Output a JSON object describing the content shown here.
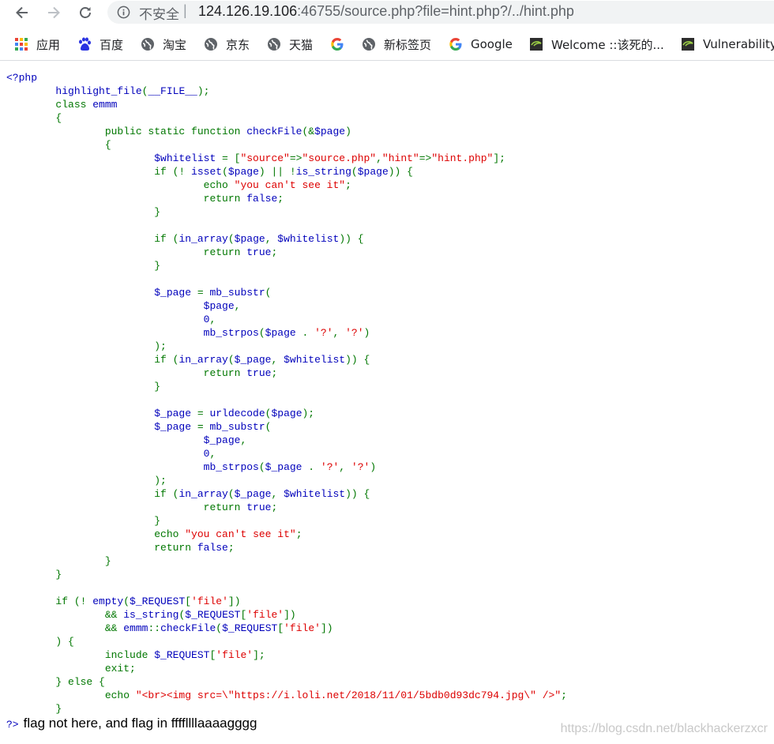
{
  "browser": {
    "security_label": "不安全",
    "separator": "|",
    "url_host": "124.126.19.106",
    "url_rest": ":46755/source.php?file=hint.php?/../hint.php",
    "bookmarks": [
      {
        "label": "应用",
        "icon": "apps-grid-icon"
      },
      {
        "label": "百度",
        "icon": "baidu-paw-icon"
      },
      {
        "label": "淘宝",
        "icon": "globe-icon"
      },
      {
        "label": "京东",
        "icon": "globe-icon"
      },
      {
        "label": "天猫",
        "icon": "globe-icon"
      },
      {
        "label": "",
        "icon": "google-g-icon"
      },
      {
        "label": "新标签页",
        "icon": "globe-icon"
      },
      {
        "label": "Google",
        "icon": "google-g-icon"
      },
      {
        "label": "Welcome ::该死的...",
        "icon": "dvwa-icon"
      },
      {
        "label": "Vulnerability",
        "icon": "dvwa-icon"
      }
    ]
  },
  "colors": {
    "keyword": "#0000bb",
    "string": "#dd0000",
    "operator": "#007700",
    "default": "#000000"
  },
  "code_lines": [
    [
      [
        "k",
        "<?php"
      ]
    ],
    [
      [
        "k",
        "        highlight_file"
      ],
      [
        "o",
        "("
      ],
      [
        "k",
        "__FILE__"
      ],
      [
        "o",
        ");"
      ]
    ],
    [
      [
        "o",
        "        class "
      ],
      [
        "k",
        "emmm"
      ]
    ],
    [
      [
        "o",
        "        {"
      ]
    ],
    [
      [
        "o",
        "                public static function "
      ],
      [
        "k",
        "checkFile"
      ],
      [
        "o",
        "(&"
      ],
      [
        "k",
        "$page"
      ],
      [
        "o",
        ")"
      ]
    ],
    [
      [
        "o",
        "                {"
      ]
    ],
    [
      [
        "k",
        "                        $whitelist "
      ],
      [
        "o",
        "= ["
      ],
      [
        "s",
        "\"source\""
      ],
      [
        "o",
        "=>"
      ],
      [
        "s",
        "\"source.php\""
      ],
      [
        "o",
        ","
      ],
      [
        "s",
        "\"hint\""
      ],
      [
        "o",
        "=>"
      ],
      [
        "s",
        "\"hint.php\""
      ],
      [
        "o",
        "];"
      ]
    ],
    [
      [
        "o",
        "                        if (! "
      ],
      [
        "k",
        "isset"
      ],
      [
        "o",
        "("
      ],
      [
        "k",
        "$page"
      ],
      [
        "o",
        ") || !"
      ],
      [
        "k",
        "is_string"
      ],
      [
        "o",
        "("
      ],
      [
        "k",
        "$page"
      ],
      [
        "o",
        ")) {"
      ]
    ],
    [
      [
        "o",
        "                                echo "
      ],
      [
        "s",
        "\"you can't see it\""
      ],
      [
        "o",
        ";"
      ]
    ],
    [
      [
        "o",
        "                                return "
      ],
      [
        "k",
        "false"
      ],
      [
        "o",
        ";"
      ]
    ],
    [
      [
        "o",
        "                        }"
      ]
    ],
    [
      [
        "o",
        ""
      ]
    ],
    [
      [
        "o",
        "                        if ("
      ],
      [
        "k",
        "in_array"
      ],
      [
        "o",
        "("
      ],
      [
        "k",
        "$page"
      ],
      [
        "o",
        ", "
      ],
      [
        "k",
        "$whitelist"
      ],
      [
        "o",
        ")) {"
      ]
    ],
    [
      [
        "o",
        "                                return "
      ],
      [
        "k",
        "true"
      ],
      [
        "o",
        ";"
      ]
    ],
    [
      [
        "o",
        "                        }"
      ]
    ],
    [
      [
        "o",
        ""
      ]
    ],
    [
      [
        "k",
        "                        $_page "
      ],
      [
        "o",
        "= "
      ],
      [
        "k",
        "mb_substr"
      ],
      [
        "o",
        "("
      ]
    ],
    [
      [
        "k",
        "                                $page"
      ],
      [
        "o",
        ","
      ]
    ],
    [
      [
        "k",
        "                                0"
      ],
      [
        "o",
        ","
      ]
    ],
    [
      [
        "k",
        "                                mb_strpos"
      ],
      [
        "o",
        "("
      ],
      [
        "k",
        "$page "
      ],
      [
        "o",
        ". "
      ],
      [
        "s",
        "'?'"
      ],
      [
        "o",
        ", "
      ],
      [
        "s",
        "'?'"
      ],
      [
        "o",
        ")"
      ]
    ],
    [
      [
        "o",
        "                        );"
      ]
    ],
    [
      [
        "o",
        "                        if ("
      ],
      [
        "k",
        "in_array"
      ],
      [
        "o",
        "("
      ],
      [
        "k",
        "$_page"
      ],
      [
        "o",
        ", "
      ],
      [
        "k",
        "$whitelist"
      ],
      [
        "o",
        ")) {"
      ]
    ],
    [
      [
        "o",
        "                                return "
      ],
      [
        "k",
        "true"
      ],
      [
        "o",
        ";"
      ]
    ],
    [
      [
        "o",
        "                        }"
      ]
    ],
    [
      [
        "o",
        ""
      ]
    ],
    [
      [
        "k",
        "                        $_page "
      ],
      [
        "o",
        "= "
      ],
      [
        "k",
        "urldecode"
      ],
      [
        "o",
        "("
      ],
      [
        "k",
        "$page"
      ],
      [
        "o",
        ");"
      ]
    ],
    [
      [
        "k",
        "                        $_page "
      ],
      [
        "o",
        "= "
      ],
      [
        "k",
        "mb_substr"
      ],
      [
        "o",
        "("
      ]
    ],
    [
      [
        "k",
        "                                $_page"
      ],
      [
        "o",
        ","
      ]
    ],
    [
      [
        "k",
        "                                0"
      ],
      [
        "o",
        ","
      ]
    ],
    [
      [
        "k",
        "                                mb_strpos"
      ],
      [
        "o",
        "("
      ],
      [
        "k",
        "$_page "
      ],
      [
        "o",
        ". "
      ],
      [
        "s",
        "'?'"
      ],
      [
        "o",
        ", "
      ],
      [
        "s",
        "'?'"
      ],
      [
        "o",
        ")"
      ]
    ],
    [
      [
        "o",
        "                        );"
      ]
    ],
    [
      [
        "o",
        "                        if ("
      ],
      [
        "k",
        "in_array"
      ],
      [
        "o",
        "("
      ],
      [
        "k",
        "$_page"
      ],
      [
        "o",
        ", "
      ],
      [
        "k",
        "$whitelist"
      ],
      [
        "o",
        ")) {"
      ]
    ],
    [
      [
        "o",
        "                                return "
      ],
      [
        "k",
        "true"
      ],
      [
        "o",
        ";"
      ]
    ],
    [
      [
        "o",
        "                        }"
      ]
    ],
    [
      [
        "o",
        "                        echo "
      ],
      [
        "s",
        "\"you can't see it\""
      ],
      [
        "o",
        ";"
      ]
    ],
    [
      [
        "o",
        "                        return "
      ],
      [
        "k",
        "false"
      ],
      [
        "o",
        ";"
      ]
    ],
    [
      [
        "o",
        "                }"
      ]
    ],
    [
      [
        "o",
        "        }"
      ]
    ],
    [
      [
        "o",
        ""
      ]
    ],
    [
      [
        "o",
        "        if (! "
      ],
      [
        "k",
        "empty"
      ],
      [
        "o",
        "("
      ],
      [
        "k",
        "$_REQUEST"
      ],
      [
        "o",
        "["
      ],
      [
        "s",
        "'file'"
      ],
      [
        "o",
        "])"
      ]
    ],
    [
      [
        "o",
        "                && "
      ],
      [
        "k",
        "is_string"
      ],
      [
        "o",
        "("
      ],
      [
        "k",
        "$_REQUEST"
      ],
      [
        "o",
        "["
      ],
      [
        "s",
        "'file'"
      ],
      [
        "o",
        "])"
      ]
    ],
    [
      [
        "o",
        "                && "
      ],
      [
        "k",
        "emmm"
      ],
      [
        "o",
        "::"
      ],
      [
        "k",
        "checkFile"
      ],
      [
        "o",
        "("
      ],
      [
        "k",
        "$_REQUEST"
      ],
      [
        "o",
        "["
      ],
      [
        "s",
        "'file'"
      ],
      [
        "o",
        "])"
      ]
    ],
    [
      [
        "o",
        "        ) {"
      ]
    ],
    [
      [
        "o",
        "                include "
      ],
      [
        "k",
        "$_REQUEST"
      ],
      [
        "o",
        "["
      ],
      [
        "s",
        "'file'"
      ],
      [
        "o",
        "];"
      ]
    ],
    [
      [
        "o",
        "                exit;"
      ]
    ],
    [
      [
        "o",
        "        } else {"
      ]
    ],
    [
      [
        "o",
        "                echo "
      ],
      [
        "s",
        "\"<br><img src=\\\"https://i.loli.net/2018/11/01/5bdb0d93dc794.jpg\\\" />\""
      ],
      [
        "o",
        ";"
      ]
    ],
    [
      [
        "o",
        "        }"
      ]
    ]
  ],
  "output": {
    "close_tag": "?>",
    "message": "flag not here, and flag in ffffllllaaaagggg"
  },
  "watermark": "https://blog.csdn.net/blackhackerzxcr"
}
